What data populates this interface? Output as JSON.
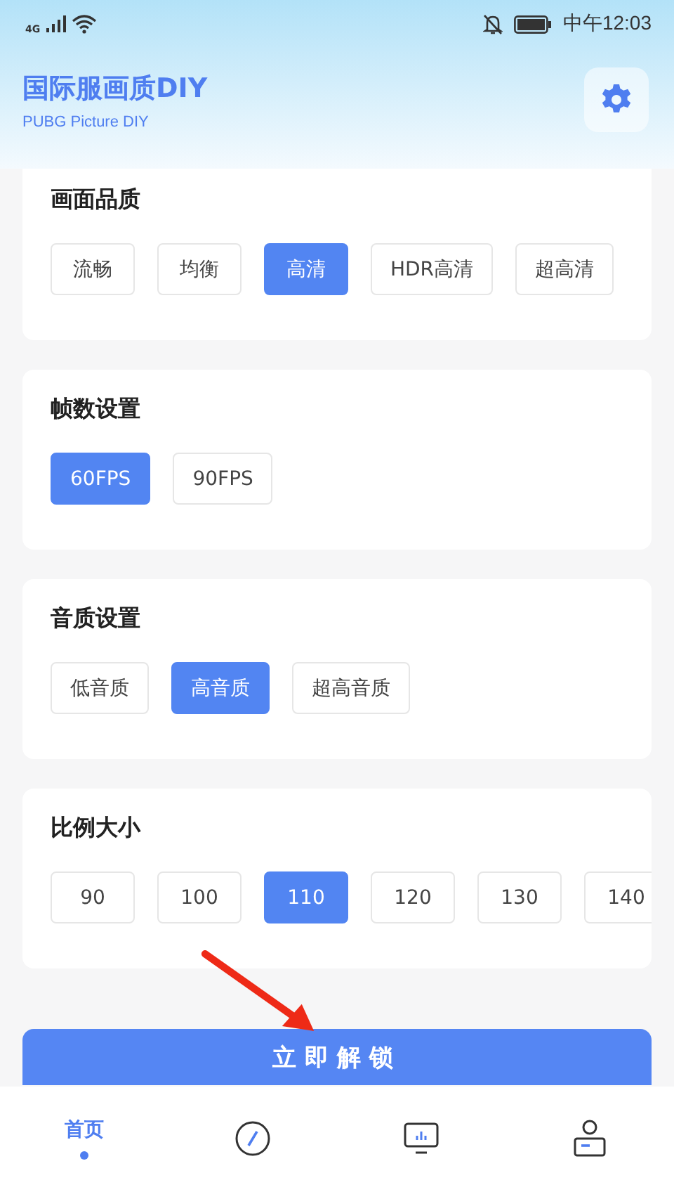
{
  "status_bar": {
    "network": "4G",
    "time": "中午12:03"
  },
  "header": {
    "title": "国际服画质DIY",
    "subtitle": "PUBG Picture DIY"
  },
  "sections": [
    {
      "title": "画面品质",
      "options": [
        {
          "label": "流畅",
          "selected": false
        },
        {
          "label": "均衡",
          "selected": false
        },
        {
          "label": "高清",
          "selected": true
        },
        {
          "label": "HDR高清",
          "selected": false
        },
        {
          "label": "超高清",
          "selected": false
        }
      ]
    },
    {
      "title": "帧数设置",
      "options": [
        {
          "label": "60FPS",
          "selected": true
        },
        {
          "label": "90FPS",
          "selected": false
        }
      ]
    },
    {
      "title": "音质设置",
      "options": [
        {
          "label": "低音质",
          "selected": false
        },
        {
          "label": "高音质",
          "selected": true
        },
        {
          "label": "超高音质",
          "selected": false
        }
      ]
    },
    {
      "title": "比例大小",
      "options": [
        {
          "label": "90",
          "selected": false
        },
        {
          "label": "100",
          "selected": false
        },
        {
          "label": "110",
          "selected": true
        },
        {
          "label": "120",
          "selected": false
        },
        {
          "label": "130",
          "selected": false
        },
        {
          "label": "140",
          "selected": false
        }
      ]
    }
  ],
  "unlock_button": "立即解锁",
  "nav": [
    {
      "kind": "text",
      "label": "首页",
      "selected": true
    },
    {
      "kind": "compass",
      "selected": false
    },
    {
      "kind": "monitor",
      "selected": false
    },
    {
      "kind": "profile",
      "selected": false
    }
  ]
}
